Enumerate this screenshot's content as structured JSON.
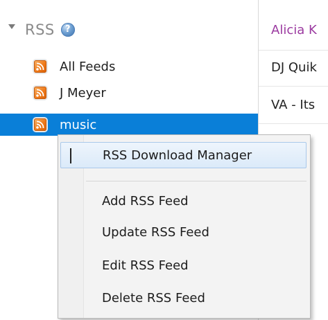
{
  "tree": {
    "section_title": "RSS",
    "help_icon": "help-icon",
    "feeds": [
      {
        "label": "All Feeds",
        "icon": "rss-feed-icon",
        "selected": false
      },
      {
        "label": "J Meyer",
        "icon": "rss-feed-icon",
        "selected": false
      },
      {
        "label": "music",
        "icon": "rss-feed-icon",
        "selected": true
      }
    ]
  },
  "right_panel": {
    "tracks": [
      "Alicia K",
      "DJ Quik",
      "VA - Its"
    ]
  },
  "context_menu": {
    "items": [
      {
        "label": "RSS Download Manager",
        "highlighted": true
      },
      {
        "label": "Add RSS Feed"
      },
      {
        "label": "Update RSS Feed"
      },
      {
        "label": "Edit RSS Feed"
      },
      {
        "label": "Delete RSS Feed"
      }
    ]
  },
  "colors": {
    "selection": "#0a7fd8",
    "first_track": "#9b3aa0",
    "rss_orange": "#ef7a1a"
  }
}
